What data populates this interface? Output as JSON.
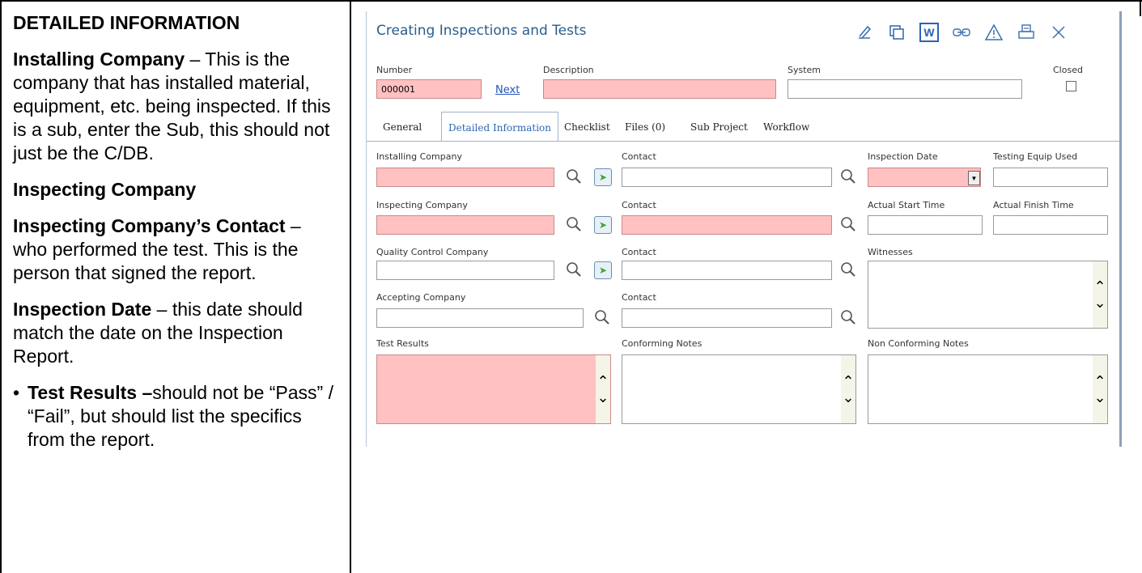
{
  "document": {
    "left": {
      "heading": "DETAILED INFORMATION",
      "p1_bold": "Installing Company",
      "p1_text": " – This is the company that has installed material, equipment, etc. being inspected.  If this is a sub, enter the Sub, this should not just be the C/DB.",
      "p2_bold": "Inspecting Company",
      "p3_bold": "Inspecting Company’s Contact",
      "p3_text": " – who performed the test.  This is the person that signed the report.",
      "p4_bold": "Inspection Date",
      "p4_text": " – this date should match the date on the Inspection Report.",
      "bullet": "•",
      "li_bold": "Test Results –",
      "li_text": "should not be “Pass” / “Fail”, but should list the specifics from the report."
    }
  },
  "app": {
    "title": "Creating Inspections and Tests",
    "toolbar": {
      "icons": [
        "edit-icon",
        "copy-icon",
        "word-icon",
        "link-icon",
        "warning-icon",
        "print-icon",
        "close-icon"
      ],
      "word_letter": "W"
    },
    "header": {
      "number_label": "Number",
      "number_value": "000001",
      "next_link": "Next",
      "description_label": "Description",
      "description_value": "",
      "system_label": "System",
      "system_value": "",
      "closed_label": "Closed"
    },
    "tabs": [
      "General",
      "Detailed Information",
      "Checklist",
      "Files (0)",
      "Sub Project",
      "Workflow"
    ],
    "active_tab": "Detailed Information",
    "labels": {
      "installing_company": "Installing Company",
      "contact1": "Contact",
      "inspection_date": "Inspection Date",
      "testing_equip": "Testing Equip Used",
      "inspecting_company": "Inspecting Company",
      "contact2": "Contact",
      "actual_start": "Actual Start Time",
      "actual_finish": "Actual Finish Time",
      "qc_company": "Quality Control Company",
      "contact3": "Contact",
      "witnesses": "Witnesses",
      "accepting_company": "Accepting Company",
      "contact4": "Contact",
      "test_results": "Test Results",
      "conforming_notes": "Conforming Notes",
      "non_conforming_notes": "Non Conforming Notes"
    },
    "colors": {
      "required": "#ffc1c1",
      "title": "#2a5d8c",
      "link": "#2456b8"
    }
  }
}
